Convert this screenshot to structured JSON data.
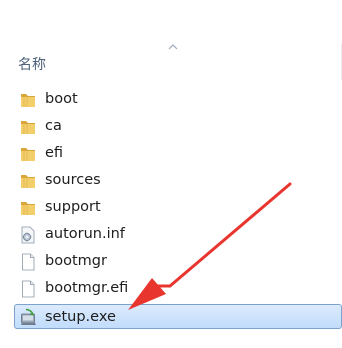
{
  "header": {
    "name_column": "名称"
  },
  "files": [
    {
      "name": "boot",
      "type": "folder-icon"
    },
    {
      "name": "ca",
      "type": "folder-icon"
    },
    {
      "name": "efi",
      "type": "folder-icon"
    },
    {
      "name": "sources",
      "type": "folder-icon"
    },
    {
      "name": "support",
      "type": "folder-icon"
    },
    {
      "name": "autorun.inf",
      "type": "settings-file-icon"
    },
    {
      "name": "bootmgr",
      "type": "blank-file-icon"
    },
    {
      "name": "bootmgr.efi",
      "type": "blank-file-icon"
    },
    {
      "name": "setup.exe",
      "type": "setup-exe-icon",
      "selected": true
    }
  ],
  "colors": {
    "selection_fill": "#c9e0fc",
    "selection_border": "#7da2ce",
    "folder": "#e8c15a",
    "annotation_arrow": "#e8362f"
  }
}
